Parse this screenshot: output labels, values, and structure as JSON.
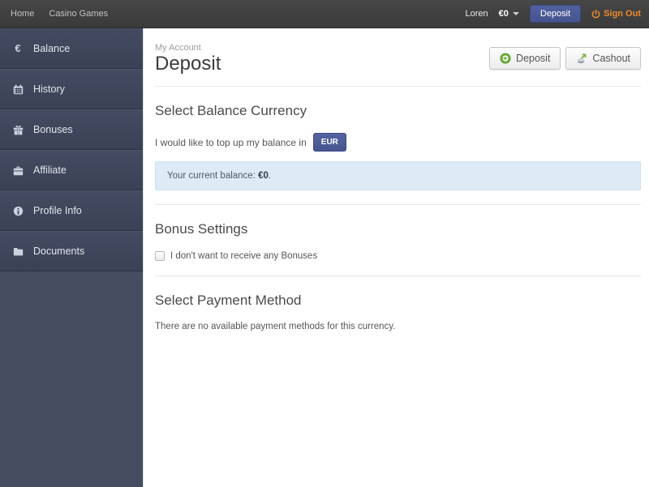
{
  "topbar": {
    "nav": [
      {
        "label": "Home"
      },
      {
        "label": "Casino Games"
      }
    ],
    "username": "Loren",
    "balance": "€0",
    "deposit_button": "Deposit",
    "signout_label": "Sign Out"
  },
  "sidebar": {
    "items": [
      {
        "label": "Balance",
        "icon": "euro-icon",
        "glyph": "€"
      },
      {
        "label": "History",
        "icon": "calendar-icon"
      },
      {
        "label": "Bonuses",
        "icon": "gift-icon"
      },
      {
        "label": "Affiliate",
        "icon": "briefcase-icon"
      },
      {
        "label": "Profile Info",
        "icon": "info-icon"
      },
      {
        "label": "Documents",
        "icon": "folder-icon"
      }
    ]
  },
  "main": {
    "breadcrumb": "My Account",
    "title": "Deposit",
    "actions": {
      "deposit": "Deposit",
      "cashout": "Cashout"
    },
    "currency_section": {
      "heading": "Select Balance Currency",
      "prompt": "I would like to top up my balance in",
      "currency": "EUR",
      "balance_label": "Your current balance:",
      "balance_value": "€0",
      "balance_suffix": "."
    },
    "bonus_section": {
      "heading": "Bonus Settings",
      "checkbox_label": "I don't want to receive any Bonuses",
      "checkbox_checked": false
    },
    "payment_section": {
      "heading": "Select Payment Method",
      "empty_message": "There are no available payment methods for this currency."
    }
  },
  "colors": {
    "topbar_bg": "#3f3f3f",
    "sidebar_bg": "#474d61",
    "accent_blue": "#4a5b9e",
    "signout_orange": "#ee8a2d",
    "info_box_bg": "#dcebf5",
    "deposit_icon_green": "#6faf3c"
  }
}
